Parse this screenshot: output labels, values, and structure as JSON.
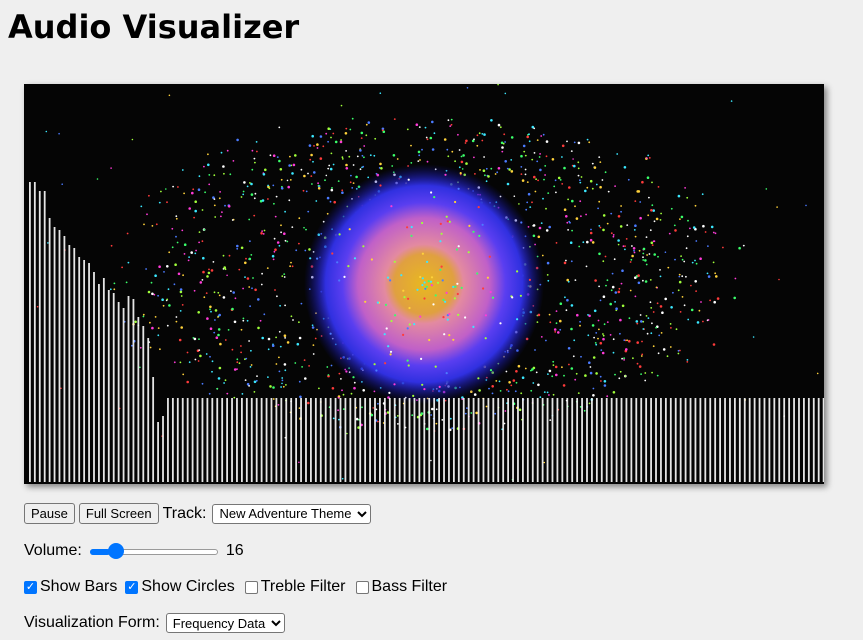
{
  "header": {
    "title": "Audio Visualizer"
  },
  "controls": {
    "pause_label": "Pause",
    "fullscreen_label": "Full Screen",
    "track_label": "Track:",
    "track_selected": "New Adventure Theme",
    "volume_label": "Volume:",
    "volume_value": 16,
    "volume_max": 100,
    "show_bars": {
      "label": "Show Bars",
      "checked": true
    },
    "show_circles": {
      "label": "Show Circles",
      "checked": true
    },
    "treble_filter": {
      "label": "Treble Filter",
      "checked": false
    },
    "bass_filter": {
      "label": "Bass Filter",
      "checked": false
    },
    "form_label": "Visualization Form:",
    "form_selected": "Frequency Data"
  },
  "visualizer": {
    "background": "#050505",
    "bar_color": "#ffffff",
    "circle_colors": [
      "#1a1aa8",
      "#3a3ae8",
      "#6a50f0",
      "#c060d0",
      "#e080a0",
      "#e8a040",
      "#e0b020"
    ],
    "bar_levels": [
      1.0,
      1.0,
      0.97,
      0.97,
      0.88,
      0.85,
      0.84,
      0.82,
      0.79,
      0.78,
      0.75,
      0.74,
      0.73,
      0.7,
      0.66,
      0.68,
      0.64,
      0.63,
      0.6,
      0.58,
      0.62,
      0.61,
      0.55,
      0.52,
      0.48,
      0.35,
      0.2,
      0.22,
      0.28,
      0.28,
      0.28,
      0.28,
      0.28,
      0.28,
      0.28,
      0.28,
      0.28,
      0.28,
      0.28,
      0.28,
      0.28,
      0.28,
      0.28,
      0.28,
      0.28,
      0.28,
      0.28,
      0.28,
      0.28,
      0.28,
      0.28,
      0.28,
      0.28,
      0.28,
      0.28,
      0.28,
      0.28,
      0.28,
      0.28,
      0.28,
      0.28,
      0.28,
      0.28,
      0.28,
      0.28,
      0.28,
      0.28,
      0.28,
      0.28,
      0.28,
      0.28,
      0.28,
      0.28,
      0.28,
      0.28,
      0.28,
      0.28,
      0.28,
      0.28,
      0.28,
      0.28,
      0.28,
      0.28,
      0.28,
      0.28,
      0.28,
      0.28,
      0.28,
      0.28,
      0.28,
      0.28,
      0.28,
      0.28,
      0.28,
      0.28,
      0.28,
      0.28,
      0.28,
      0.28,
      0.28,
      0.28,
      0.28,
      0.28,
      0.28,
      0.28,
      0.28,
      0.28,
      0.28,
      0.28,
      0.28,
      0.28,
      0.28,
      0.28,
      0.28,
      0.28,
      0.28,
      0.28,
      0.28,
      0.28,
      0.28,
      0.28,
      0.28,
      0.28,
      0.28,
      0.28,
      0.28,
      0.28,
      0.28,
      0.28,
      0.28,
      0.28,
      0.28,
      0.28,
      0.28,
      0.28,
      0.28,
      0.28,
      0.28,
      0.28,
      0.28,
      0.28,
      0.28,
      0.28,
      0.28,
      0.28,
      0.28,
      0.28,
      0.28,
      0.28,
      0.28,
      0.28,
      0.28,
      0.28,
      0.28,
      0.28,
      0.28,
      0.28,
      0.28,
      0.28,
      0.28,
      0.28,
      0.28,
      0.28,
      0.28,
      0.28,
      0.28
    ]
  }
}
